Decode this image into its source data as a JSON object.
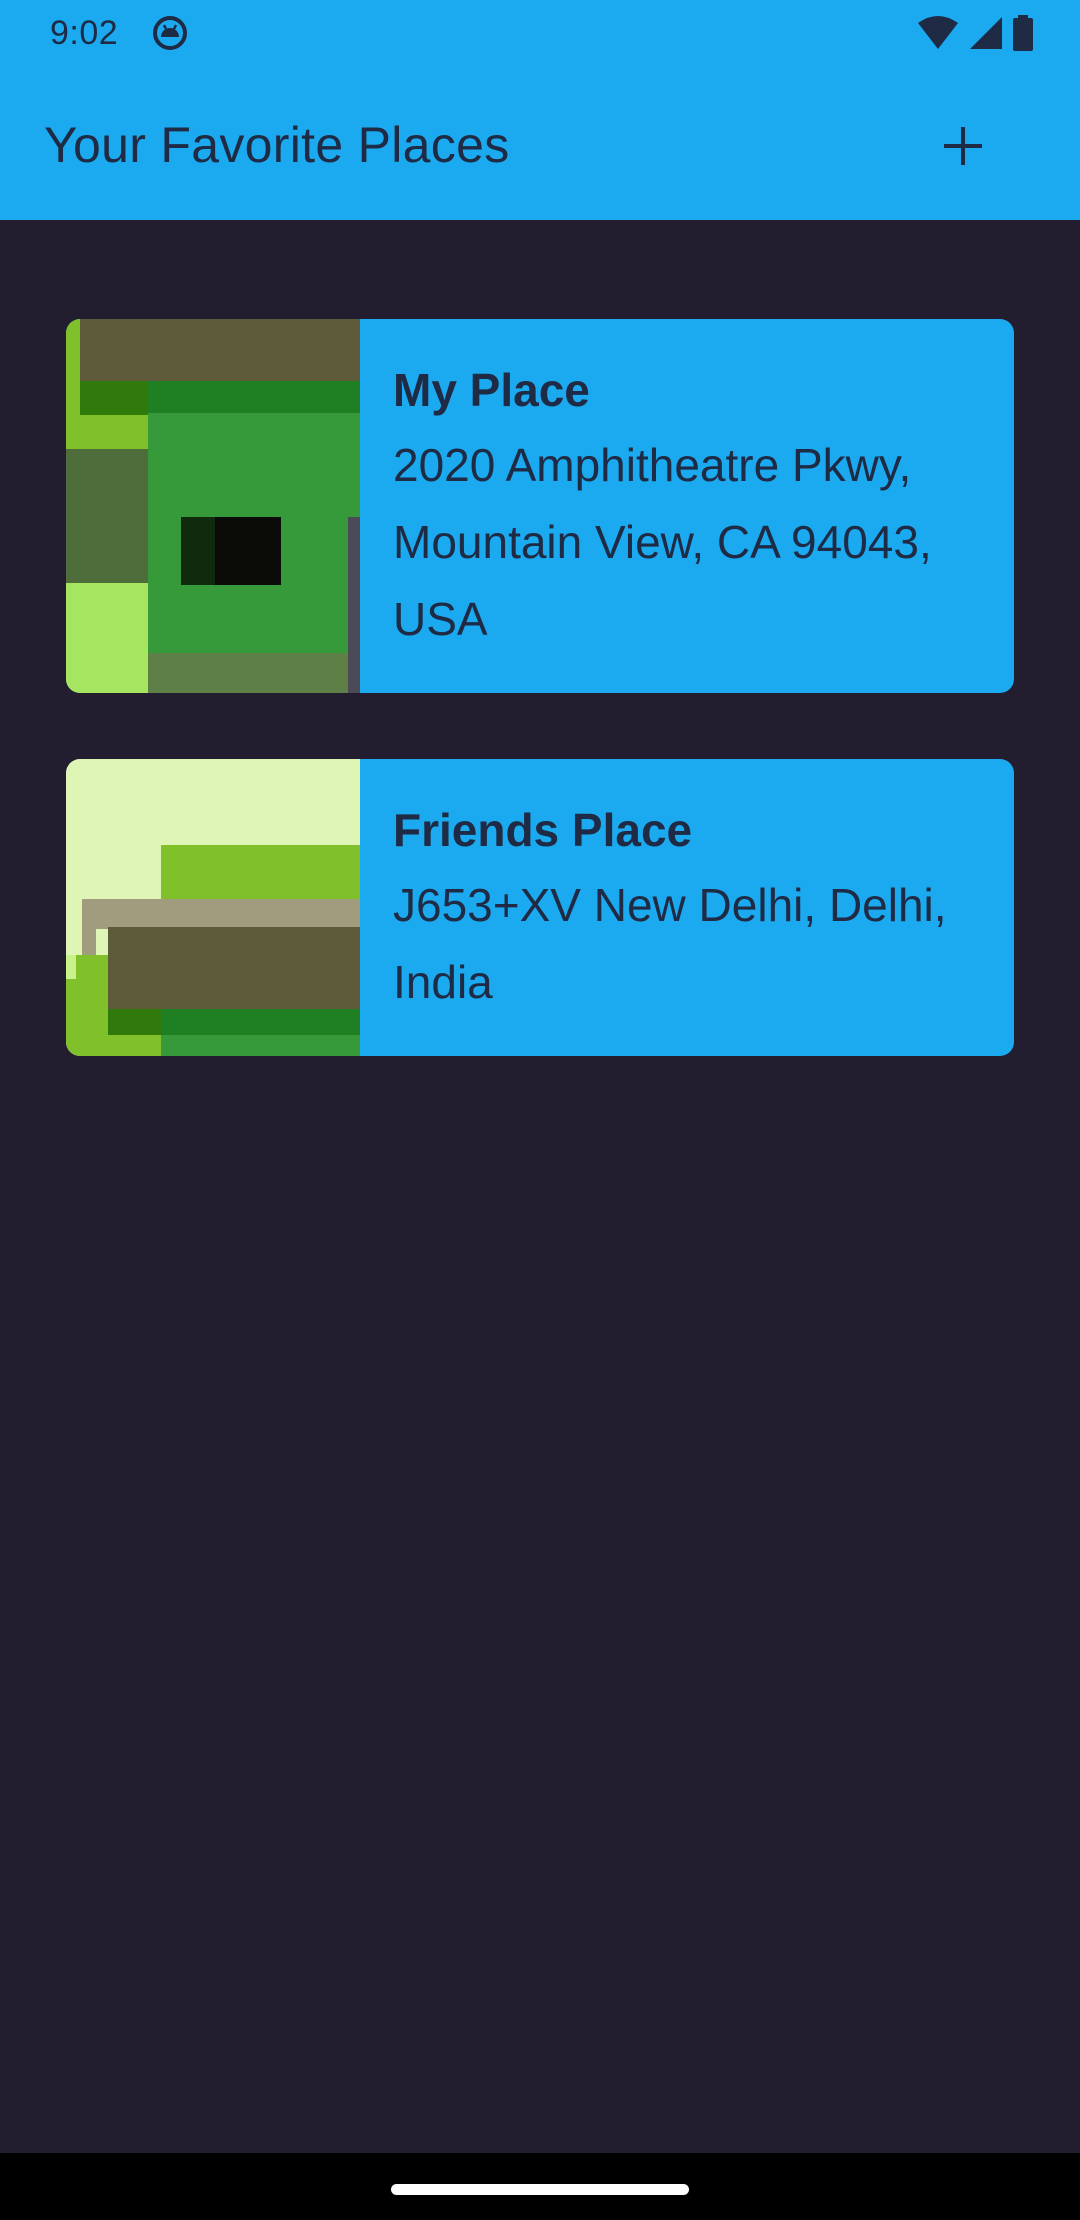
{
  "status_bar": {
    "time": "9:02",
    "app_icon": "android-debug-icon",
    "right_icons": [
      "wifi-icon",
      "signal-icon",
      "battery-icon"
    ]
  },
  "app_bar": {
    "title": "Your Favorite Places",
    "add_icon": "plus-icon"
  },
  "places": [
    {
      "title": "My Place",
      "address": "2020 Amphitheatre Pkwy, Mountain View, CA 94043, USA",
      "thumbnail": "map-thumbnail"
    },
    {
      "title": "Friends Place",
      "address": "J653+XV New Delhi, Delhi, India",
      "thumbnail": "map-thumbnail"
    }
  ],
  "colors": {
    "accent": "#1baaef",
    "background": "#221e30",
    "text": "#1f2a44"
  }
}
